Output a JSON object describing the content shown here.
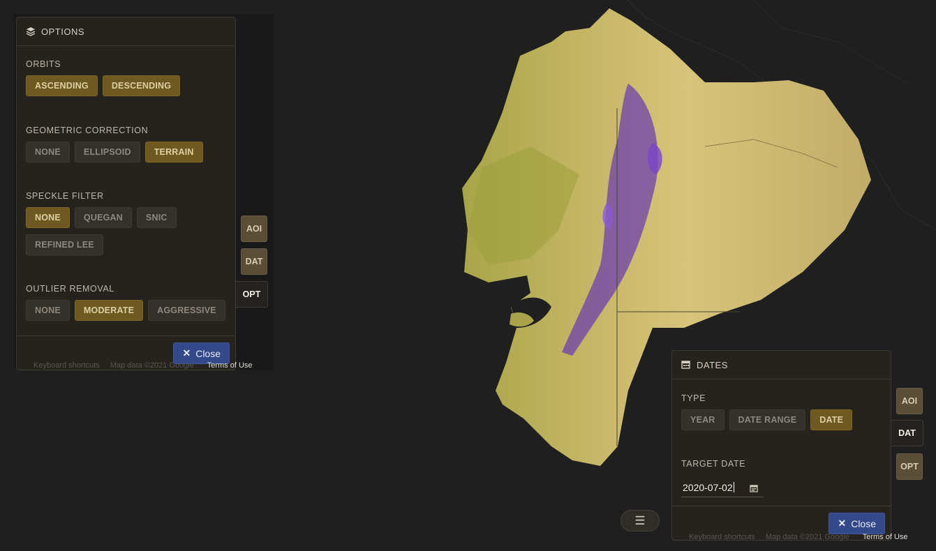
{
  "options_panel": {
    "title": "OPTIONS",
    "icon": "layers-icon",
    "sections": [
      {
        "label": "ORBITS",
        "buttons": [
          {
            "label": "ASCENDING",
            "selected": true
          },
          {
            "label": "DESCENDING",
            "selected": true
          }
        ]
      },
      {
        "label": "GEOMETRIC CORRECTION",
        "buttons": [
          {
            "label": "NONE",
            "selected": false
          },
          {
            "label": "ELLIPSOID",
            "selected": false
          },
          {
            "label": "TERRAIN",
            "selected": true
          }
        ]
      },
      {
        "label": "SPECKLE FILTER",
        "buttons": [
          {
            "label": "NONE",
            "selected": true
          },
          {
            "label": "QUEGAN",
            "selected": false
          },
          {
            "label": "SNIC",
            "selected": false
          },
          {
            "label": "REFINED LEE",
            "selected": false
          }
        ]
      },
      {
        "label": "OUTLIER REMOVAL",
        "buttons": [
          {
            "label": "NONE",
            "selected": false
          },
          {
            "label": "MODERATE",
            "selected": true
          },
          {
            "label": "AGGRESSIVE",
            "selected": false
          }
        ]
      }
    ],
    "close_label": "Close"
  },
  "dates_panel": {
    "title": "DATES",
    "icon": "calendar-icon",
    "type_label": "TYPE",
    "type_buttons": [
      {
        "label": "YEAR",
        "selected": false
      },
      {
        "label": "DATE RANGE",
        "selected": false
      },
      {
        "label": "DATE",
        "selected": true
      }
    ],
    "target_label": "TARGET DATE",
    "target_value": "2020-07-02",
    "close_label": "Close"
  },
  "left_tabs": {
    "aoi": "AOI",
    "dat": "DAT",
    "opt": "OPT",
    "active": "OPT"
  },
  "right_tabs": {
    "aoi": "AOI",
    "dat": "DAT",
    "opt": "OPT",
    "active": "DAT"
  },
  "attribution": {
    "shortcuts": "Keyboard shortcuts",
    "map_data": "Map data ©2021 Google",
    "terms": "Terms of Use"
  },
  "menu_icon": "hamburger-menu-icon",
  "colors": {
    "selected": "#6e5a21",
    "close_button": "#34498a",
    "raster_base": "#c8b566",
    "raster_high": "#6a3bb0"
  }
}
